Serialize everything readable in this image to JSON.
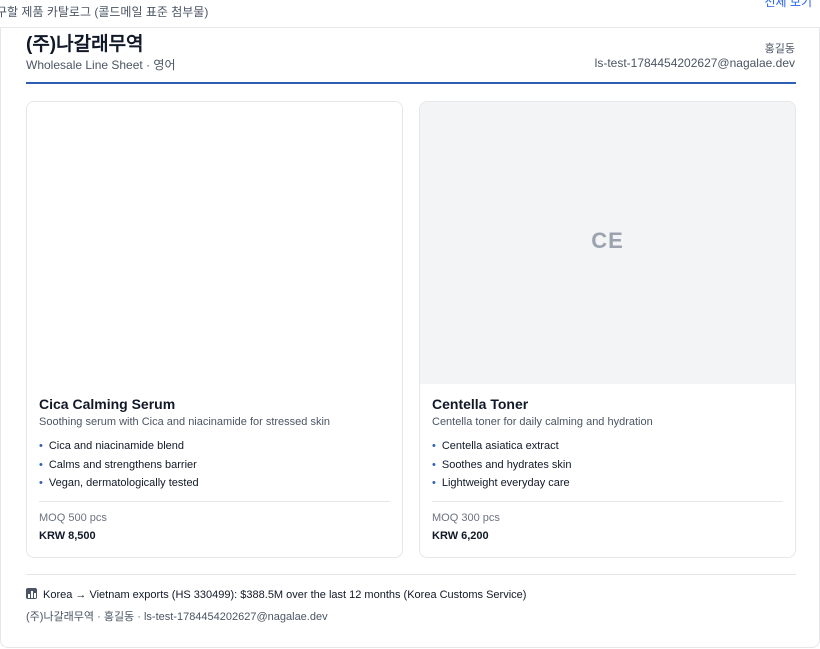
{
  "topbar": {
    "title": "구할 제품 카탈로그 (콜드메일 표준 첨부물)",
    "action_label": "전체 보기"
  },
  "header": {
    "company_name": "(주)나갈래무역",
    "subtitle": "Wholesale Line Sheet · 영어",
    "contact_name": "홍길동",
    "contact_email": "ls-test-1784454202627@nagalae.dev",
    "accent_color": "#2f5fb3"
  },
  "products": [
    {
      "name": "Cica Calming Serum",
      "description": "Soothing serum with Cica and niacinamide for stressed skin",
      "image_placeholder": "",
      "features": [
        "Cica and niacinamide blend",
        "Calms and strengthens barrier",
        "Vegan, dermatologically tested"
      ],
      "moq": "MOQ 500 pcs",
      "price": "KRW 8,500"
    },
    {
      "name": "Centella Toner",
      "description": "Centella toner for daily calming and hydration",
      "image_placeholder": "CE",
      "features": [
        "Centella asiatica extract",
        "Soothes and hydrates skin",
        "Lightweight everyday care"
      ],
      "moq": "MOQ 300 pcs",
      "price": "KRW 6,200"
    }
  ],
  "footer": {
    "icon": "bar-chart-icon",
    "export_stat": "Korea → Vietnam exports (HS 330499): $388.5M over the last 12 months (Korea Customs Service)",
    "contact_line": "(주)나갈래무역 · 홍길동 · ls-test-1784454202627@nagalae.dev"
  }
}
